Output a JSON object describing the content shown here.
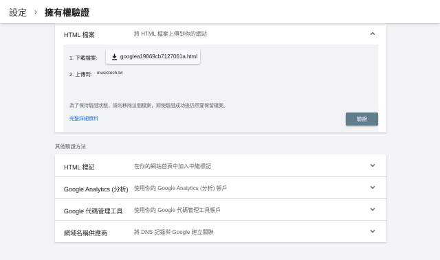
{
  "breadcrumb": {
    "root": "設定",
    "separator": "›",
    "current": "擁有權驗證"
  },
  "html_file": {
    "title": "HTML 檔案",
    "description": "將 HTML 檔案上傳到你的網站",
    "expand_icon": "chevron-up-icon",
    "step1_label": "1. 下載檔案:",
    "download_icon": "download-icon",
    "download_filename": "googlea19869cb7127061a.html",
    "step2_label": "2. 上傳到:",
    "site": "musictech.tw",
    "note": "為了保持驗證狀態，請勿移除這個檔案，即使驗證成功後仍然要保留檔案。",
    "details_link": "完整詳細資料",
    "verify_label": "驗證"
  },
  "other_methods": {
    "label": "其他驗證方法",
    "items": [
      {
        "title": "HTML 標記",
        "description": "在你的網站首頁中加入中繼標記"
      },
      {
        "title": "Google Analytics (分析)",
        "description": "使用你的 Google Analytics (分析) 帳戶"
      },
      {
        "title": "Google 代碼管理工具",
        "description": "使用你的 Google 代碼管理工具帳戶"
      },
      {
        "title": "網域名稱供應商",
        "description": "將 DNS 記錄與 Google 建立關聯"
      }
    ],
    "expand_icon": "chevron-down-icon"
  },
  "colors": {
    "background": "#f1f3f4",
    "link": "#1a73e8",
    "verify_button": "#607d8b"
  }
}
